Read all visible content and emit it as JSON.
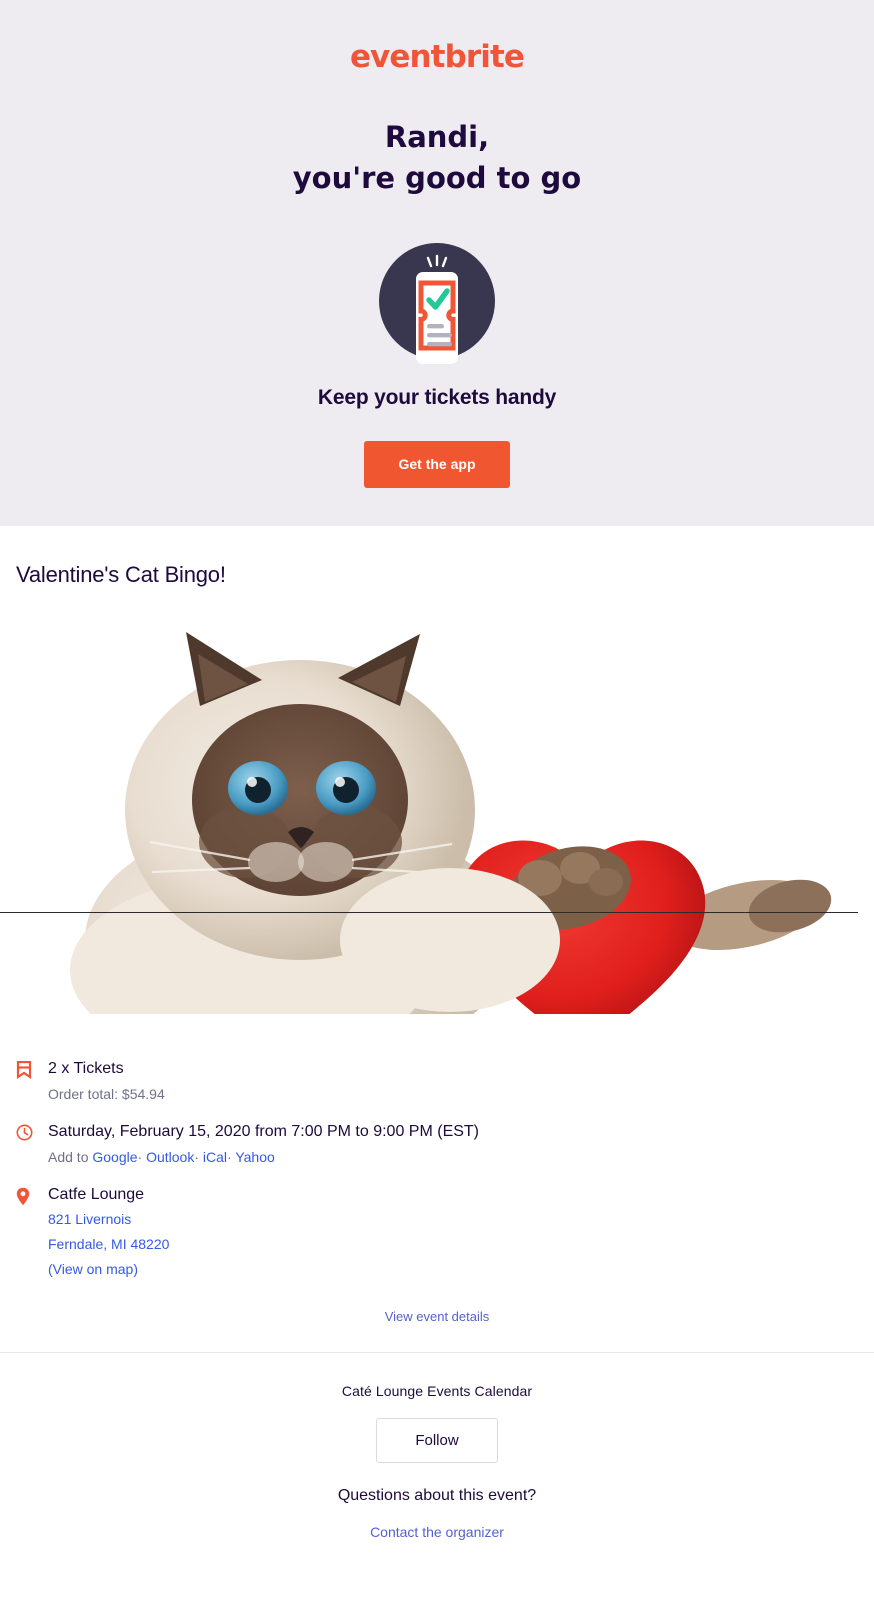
{
  "brand": {
    "logo_text": "eventbrite",
    "orange": "#F05537",
    "navy": "#1E0A3C",
    "link": "#3659E3"
  },
  "hero": {
    "greeting_line1": "Randi,",
    "greeting_line2": "you're good to go",
    "illustration_name": "phone-ticket-check-illustration",
    "tagline": "Keep your tickets handy",
    "app_button": "Get the app"
  },
  "event": {
    "title": "Valentine's Cat Bingo!",
    "image_alt": "himalayan-cat-with-red-heart-pillow"
  },
  "tickets": {
    "icon": "ticket-icon",
    "quantity_label": "2 x Tickets",
    "order_total": "Order total: $54.94"
  },
  "datetime": {
    "icon": "clock-icon",
    "when": "Saturday, February 15, 2020 from 7:00 PM to 9:00 PM (EST)",
    "add_to_label": "Add to",
    "calendar_links": [
      "Google",
      "Outlook",
      "iCal",
      "Yahoo"
    ],
    "separator": "·"
  },
  "venue": {
    "icon": "location-pin-icon",
    "name": "Catfe Lounge",
    "street": "821 Livernois",
    "city_state_zip": "Ferndale, MI 48220",
    "map_link": "(View on map)"
  },
  "links": {
    "view_event_details": "View event details"
  },
  "footer": {
    "organizer": "Caté Lounge Events Calendar",
    "follow_button": "Follow",
    "questions": "Questions about this event?",
    "contact_link": "Contact the organizer"
  }
}
